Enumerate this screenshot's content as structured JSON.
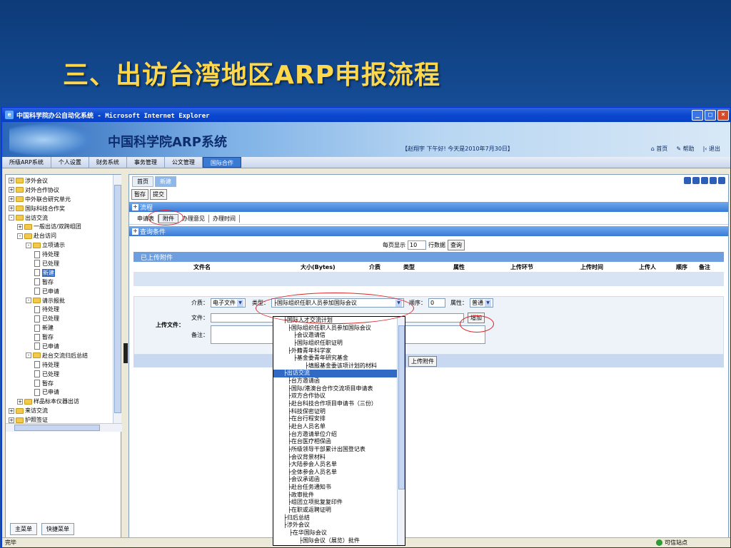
{
  "slide": {
    "title_cn1": "三、出访台湾地区",
    "title_latin": "ARP",
    "title_cn2": "申报流程"
  },
  "window": {
    "title": "中国科学院办公自动化系统 - Microsoft Internet Explorer",
    "min": "_",
    "max": "□",
    "close": "×"
  },
  "banner": {
    "system_title": "中国科学院ARP系统",
    "greeting": "【赵翔宇 下午好! 今天是2010年7月30日】",
    "links": {
      "home": "首页",
      "help": "帮助",
      "logout": "退出"
    }
  },
  "main_menu": [
    "所级ARP系统",
    "个人设置",
    "财务系统",
    "事务管理",
    "公文管理",
    "国际合作"
  ],
  "tree": [
    {
      "label": "涉外会议",
      "level": 0,
      "type": "folder",
      "pm": "+"
    },
    {
      "label": "对外合作协议",
      "level": 0,
      "type": "folder",
      "pm": "+"
    },
    {
      "label": "中外联合研究单元",
      "level": 0,
      "type": "folder",
      "pm": "+"
    },
    {
      "label": "国际科技合作奖",
      "level": 0,
      "type": "folder",
      "pm": "+"
    },
    {
      "label": "出访交流",
      "level": 0,
      "type": "folder",
      "pm": "-"
    },
    {
      "label": "一般出访/双跨组团",
      "level": 1,
      "type": "folder",
      "pm": "+"
    },
    {
      "label": "赴台访问",
      "level": 1,
      "type": "folder",
      "pm": "-"
    },
    {
      "label": "立项请示",
      "level": 2,
      "type": "folder",
      "pm": "-"
    },
    {
      "label": "待处理",
      "level": 3,
      "type": "doc"
    },
    {
      "label": "已处理",
      "level": 3,
      "type": "doc"
    },
    {
      "label": "新建",
      "level": 3,
      "type": "doc",
      "selected": true
    },
    {
      "label": "暂存",
      "level": 3,
      "type": "doc"
    },
    {
      "label": "已申请",
      "level": 3,
      "type": "doc"
    },
    {
      "label": "请示报批",
      "level": 2,
      "type": "folder",
      "pm": "-"
    },
    {
      "label": "待处理",
      "level": 3,
      "type": "doc"
    },
    {
      "label": "已处理",
      "level": 3,
      "type": "doc"
    },
    {
      "label": "新建",
      "level": 3,
      "type": "doc"
    },
    {
      "label": "暂存",
      "level": 3,
      "type": "doc"
    },
    {
      "label": "已申请",
      "level": 3,
      "type": "doc"
    },
    {
      "label": "赴台交流归后总结",
      "level": 2,
      "type": "folder",
      "pm": "-"
    },
    {
      "label": "待处理",
      "level": 3,
      "type": "doc"
    },
    {
      "label": "已处理",
      "level": 3,
      "type": "doc"
    },
    {
      "label": "暂存",
      "level": 3,
      "type": "doc"
    },
    {
      "label": "已申请",
      "level": 3,
      "type": "doc"
    },
    {
      "label": "样品标本仪器出访",
      "level": 1,
      "type": "folder",
      "pm": "+"
    },
    {
      "label": "来访交流",
      "level": 0,
      "type": "folder",
      "pm": "+"
    },
    {
      "label": "护照签证",
      "level": 0,
      "type": "folder",
      "pm": "+"
    }
  ],
  "tree_tabs": [
    "主菜单",
    "快捷菜单"
  ],
  "content": {
    "tabs": [
      "首页",
      "新建"
    ],
    "buttons": {
      "save_draft": "暂存",
      "submit": "提交"
    },
    "flow_section": "流程",
    "form_tabs": [
      "申请表",
      "附件",
      "办理意见",
      "办理时间"
    ],
    "query_section": "查询条件",
    "per_page_label": "每页显示",
    "per_page_value": "10",
    "per_page_unit": "行数据",
    "query_button": "查询",
    "uploaded_section": "已上传附件",
    "columns": [
      "文件名",
      "大小(Bytes)",
      "介质",
      "类型",
      "属性",
      "上传环节",
      "上传时间",
      "上传人",
      "顺序",
      "备注"
    ],
    "upload": {
      "title": "上传文件：",
      "medium_label": "介质：",
      "medium_value": "电子文件",
      "type_label": "类型：",
      "type_value": "├国际组织任职人员参加国际会议",
      "order_label": "顺序：",
      "order_value": "0",
      "attr_label": "属性：",
      "attr_value": "普通",
      "file_label": "文件：",
      "note_label": "备注：",
      "add_button": "增加",
      "upload_button": "上传附件"
    }
  },
  "dropdown_items": [
    "├国际人才交流计划",
    "├国际组织任职人员参加国际会议",
    "├会议邀请信",
    "├国际组织任职证明",
    "├外籍青年科学家",
    "├基金委青年研究基金",
    "├填报基金委该项计划的材料",
    "├出访交流",
    "├台方邀请函",
    "├国际/港澳台合作交流项目申请表",
    "├双方合作协议",
    "├赴台科技合作项目申请书（三份）",
    "├科技保密证明",
    "├在台行程安排",
    "├赴台人员名单",
    "├台方邀请单位介绍",
    "├在台医疗相保函",
    "├所级领导干部累计出国登记表",
    "├会议背景材料",
    "├大陆参会人员名单",
    "├全体参会人员名单",
    "├会议承诺函",
    "├赴台任务通知书",
    "├政审批件",
    "├组团立项批复复印件",
    "├在职或返聘证明",
    "├归后总结",
    "├涉外会议",
    "├在华国际会议",
    "├国际会议（展览）批件"
  ],
  "dropdown_selected": 7,
  "status": {
    "left": "完毕",
    "zone": "可信站点"
  }
}
